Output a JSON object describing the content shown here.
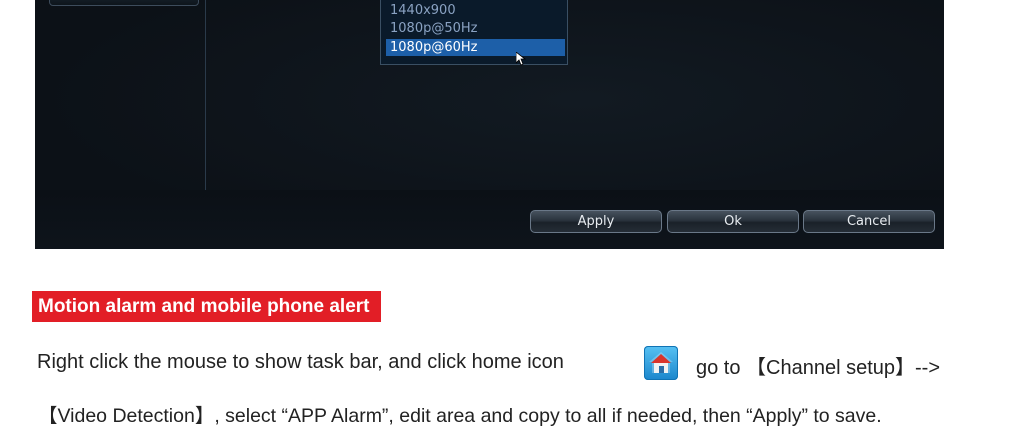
{
  "dvr": {
    "resolution_options": [
      "1440x900",
      "1080p@50Hz",
      "1080p@60Hz"
    ],
    "selected_option": "1080p@60Hz",
    "buttons": {
      "apply": "Apply",
      "ok": "Ok",
      "cancel": "Cancel"
    },
    "selection_color": "#1d5fa8"
  },
  "section": {
    "title": "Motion alarm and mobile phone alert",
    "accent_color": "#e21e26"
  },
  "instructions": {
    "line1_before_icon": "Right  click  the  mouse  to  show  task  bar,  and  click  home  icon",
    "home_icon": "home-icon",
    "line1_after_icon": "go  to   【Channel  setup】-->",
    "line2": "【Video Detection】, select “APP Alarm”, edit area and copy to all if needed, then “Apply” to save."
  }
}
